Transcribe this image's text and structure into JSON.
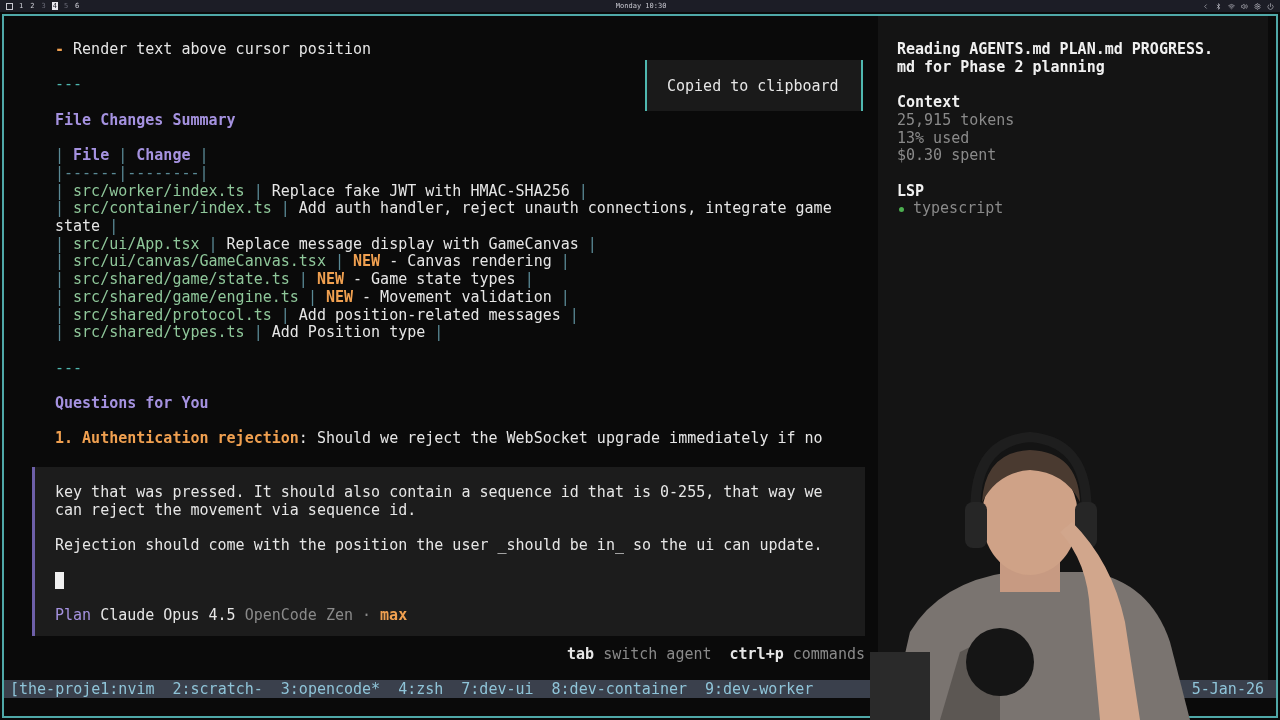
{
  "topbar": {
    "workspaces": [
      {
        "label": "1",
        "selected": false,
        "occupied": true
      },
      {
        "label": "2",
        "selected": false,
        "occupied": true
      },
      {
        "label": "3",
        "selected": false,
        "occupied": false
      },
      {
        "label": "4",
        "selected": true,
        "occupied": true
      },
      {
        "label": "5",
        "selected": false,
        "occupied": false
      },
      {
        "label": "6",
        "selected": false,
        "occupied": true
      }
    ],
    "clock": "Monday 10:30"
  },
  "transcript": [
    {
      "kind": "bullet",
      "marker": "-",
      "text": "Render text above cursor position"
    },
    {
      "kind": "rule",
      "text": "---"
    },
    {
      "kind": "heading",
      "text": "File Changes Summary"
    },
    {
      "kind": "table",
      "pipe": "|",
      "header": [
        "File",
        "Change"
      ],
      "separator": "|------|--------|",
      "rows": [
        {
          "file": "src/worker/index.ts",
          "change": "Replace fake JWT with HMAC-SHA256"
        },
        {
          "file": "src/container/index.ts",
          "change": "Add auth handler, reject unauth connections, integrate game state"
        },
        {
          "file": "src/ui/App.tsx",
          "change": "Replace message display with GameCanvas"
        },
        {
          "file": "src/ui/canvas/GameCanvas.tsx",
          "tag": "NEW",
          "change": "- Canvas rendering"
        },
        {
          "file": "src/shared/game/state.ts",
          "tag": "NEW",
          "change": "- Game state types"
        },
        {
          "file": "src/shared/game/engine.ts",
          "tag": "NEW",
          "change": "- Movement validation"
        },
        {
          "file": "src/shared/protocol.ts",
          "change": "Add position-related messages"
        },
        {
          "file": "src/shared/types.ts",
          "change": "Add Position type"
        }
      ]
    },
    {
      "kind": "rule",
      "text": "---"
    },
    {
      "kind": "heading",
      "text": "Questions for You"
    },
    {
      "kind": "numbered",
      "number": "1.",
      "label": "Authentication rejection",
      "text": ": Should we reject the WebSocket upgrade immediately if no"
    }
  ],
  "toast": "Copied to clipboard",
  "prompt": {
    "paragraphs": [
      "key that was pressed. It should also contain a sequence id that is 0-255, that way we can reject the movement via sequence id.",
      "Rejection should come with the position the user _should be in_ so the ui can update."
    ],
    "mode": "Plan",
    "model": "Claude Opus 4.5",
    "provider": "OpenCode Zen",
    "separator": "·",
    "variant": "max"
  },
  "hints": [
    {
      "key": "tab",
      "action": "switch agent"
    },
    {
      "key": "ctrl+p",
      "action": "commands"
    }
  ],
  "sidebar": {
    "title": "Reading AGENTS.md PLAN.md PROGRESS.md for Phase 2 planning",
    "context": {
      "heading": "Context",
      "lines": [
        "25,915 tokens",
        "13% used",
        "$0.30 spent"
      ]
    },
    "lsp": {
      "heading": "LSP",
      "servers": [
        {
          "name": "typescript",
          "color": "#4caf50"
        }
      ]
    }
  },
  "tmux": {
    "windows": [
      "[the-proje1:nvim",
      "2:scratch-",
      "3:opencode*",
      "4:zsh",
      "7:dev-ui",
      "8:dev-container",
      "9:dev-worker"
    ],
    "date": "5-Jan-26"
  }
}
